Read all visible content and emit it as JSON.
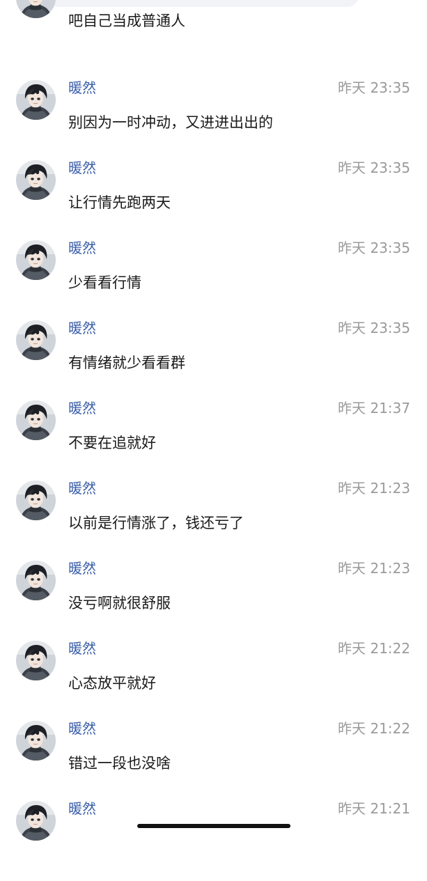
{
  "chat": {
    "partial_top": {
      "text": "吧自己当成普通人"
    },
    "messages": [
      {
        "sender": "暖然",
        "time": "昨天 23:35",
        "text": "别因为一时冲动，又进进出出的"
      },
      {
        "sender": "暖然",
        "time": "昨天 23:35",
        "text": "让行情先跑两天"
      },
      {
        "sender": "暖然",
        "time": "昨天 23:35",
        "text": "少看看行情"
      },
      {
        "sender": "暖然",
        "time": "昨天 23:35",
        "text": "有情绪就少看看群"
      },
      {
        "sender": "暖然",
        "time": "昨天 21:37",
        "text": "不要在追就好"
      },
      {
        "sender": "暖然",
        "time": "昨天 21:23",
        "text": "以前是行情涨了，钱还亏了"
      },
      {
        "sender": "暖然",
        "time": "昨天 21:23",
        "text": "没亏啊就很舒服"
      },
      {
        "sender": "暖然",
        "time": "昨天 21:22",
        "text": "心态放平就好"
      },
      {
        "sender": "暖然",
        "time": "昨天 21:22",
        "text": "错过一段也没啥"
      },
      {
        "sender": "暖然",
        "time": "昨天 21:21",
        "text": ""
      }
    ]
  },
  "colors": {
    "sender_name": "#3a5ea8",
    "timestamp": "#9a9a9a",
    "message_text": "#1a1a1a",
    "background": "#ffffff"
  },
  "icons": {
    "avatar": "anime-boy-avatar"
  }
}
